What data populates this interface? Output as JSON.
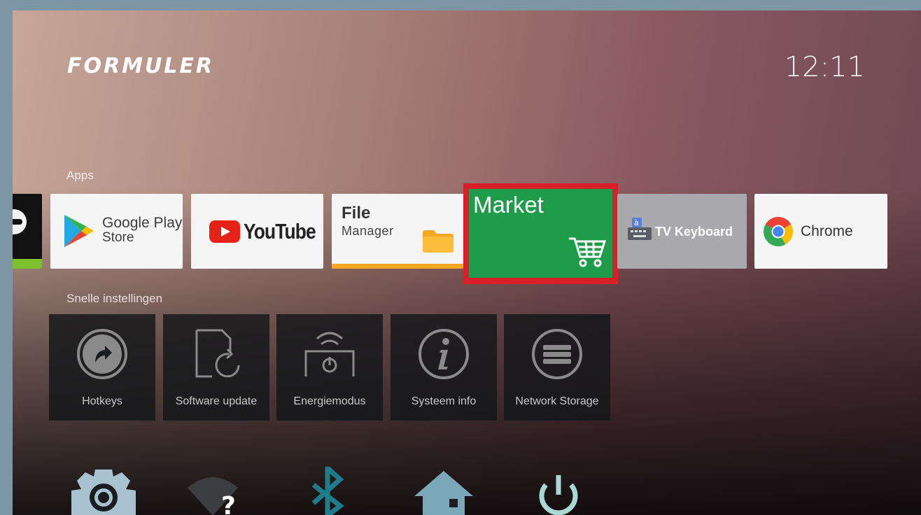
{
  "header": {
    "brand": "FORMULER",
    "clock": "12:11"
  },
  "sections": {
    "apps": "Apps",
    "quick_settings": "Snelle instellingen"
  },
  "apps": {
    "google_play": {
      "line1": "Google Play",
      "line2": "Store"
    },
    "youtube": {
      "label": "YouTube"
    },
    "file_manager": {
      "title": "File",
      "subtitle": "Manager"
    },
    "market": {
      "label": "Market",
      "focused": true
    },
    "tv_keyboard": {
      "label": "TV Keyboard"
    },
    "chrome": {
      "label": "Chrome"
    }
  },
  "quick_settings": [
    {
      "label": "Hotkeys",
      "icon": "hotkey-arrow-icon"
    },
    {
      "label": "Software update",
      "icon": "software-update-icon"
    },
    {
      "label": "Energiemodus",
      "icon": "energy-mode-icon"
    },
    {
      "label": "Systeem info",
      "icon": "info-icon"
    },
    {
      "label": "Network Storage",
      "icon": "network-storage-icon"
    }
  ],
  "bottom_bar": [
    "settings-gear-icon",
    "wifi-unknown-icon",
    "bluetooth-icon",
    "home-network-icon",
    "power-icon"
  ],
  "colors": {
    "market_bg": "#1f9c4a",
    "focus_frame": "#d9202a",
    "accent_orange": "#f5a623",
    "youtube_red": "#e62117"
  }
}
